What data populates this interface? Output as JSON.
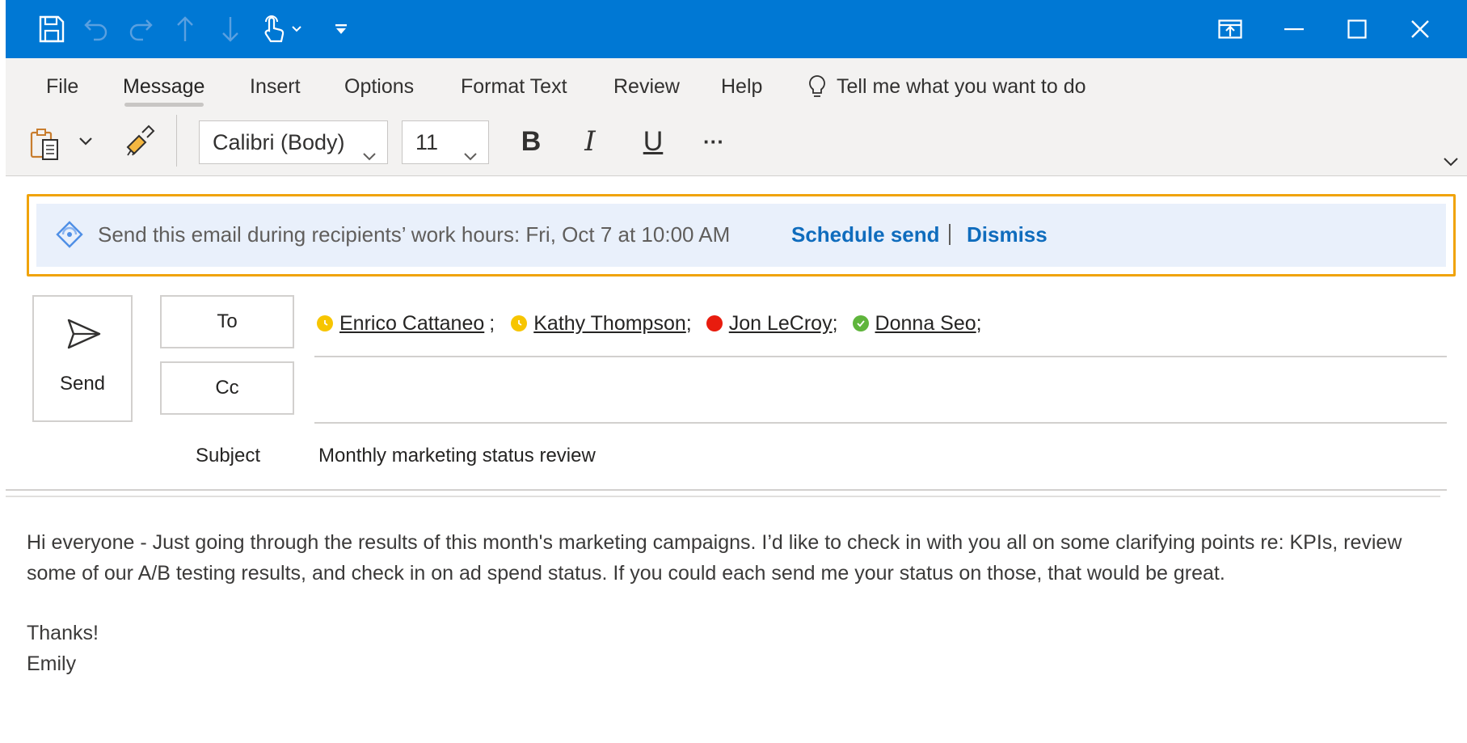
{
  "colors": {
    "title_bar": "#0078d4",
    "ribbon": "#f3f2f1",
    "notify_bg": "#e9f0fb",
    "notify_border": "#f0a30a",
    "link": "#0f6cbd",
    "away": "#f7c500",
    "busy": "#e81c0e",
    "available": "#5fb53c"
  },
  "titlebar": {
    "icons": [
      "save-icon",
      "undo-icon",
      "redo-icon",
      "up-arrow-icon",
      "down-arrow-icon",
      "touch-mode-icon",
      "chevron-down-icon",
      "customize-qat-icon",
      "ribbon-display-icon",
      "minimize-icon",
      "maximize-icon",
      "close-icon"
    ]
  },
  "menu": {
    "tabs": [
      "File",
      "Message",
      "Insert",
      "Options",
      "Format Text",
      "Review",
      "Help"
    ],
    "active": "Message",
    "tell_me": "Tell me what you want to do"
  },
  "toolbar": {
    "font_name": "Calibri (Body)",
    "font_size": "11",
    "bold": "B",
    "italic": "I",
    "underline": "U",
    "more": "···"
  },
  "notification": {
    "text": "Send this email during recipients’ work hours: Fri, Oct 7 at 10:00 AM",
    "schedule_label": "Schedule send",
    "dismiss_label": "Dismiss"
  },
  "compose": {
    "send_label": "Send",
    "to_label": "To",
    "cc_label": "Cc",
    "subject_label": "Subject",
    "subject_value": "Monthly marketing status review",
    "recipients": [
      {
        "name": "Enrico Cattaneo",
        "sep": ";",
        "status": "away"
      },
      {
        "name": "Kathy Thompson",
        "sep": ";",
        "status": "away"
      },
      {
        "name": "Jon LeCroy",
        "sep": ";",
        "status": "busy"
      },
      {
        "name": "Donna Seo",
        "sep": ";",
        "status": "available"
      }
    ]
  },
  "body": {
    "paragraph": "Hi everyone - Just going through the results of this month's marketing campaigns. I’d like to check in with you all on some clarifying points re: KPIs, review some of our A/B testing results, and check in on ad spend status. If you could each send me your status on those, that would be great.",
    "closing": "Thanks!",
    "signature": "Emily"
  }
}
